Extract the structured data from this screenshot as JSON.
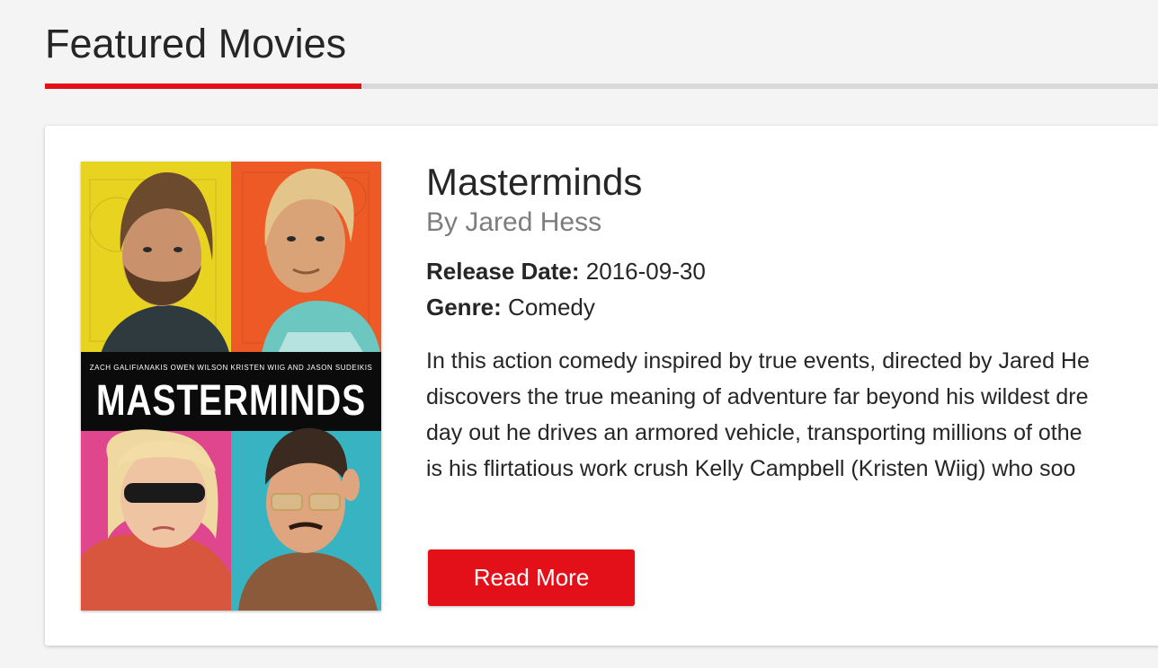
{
  "section": {
    "title": "Featured Movies"
  },
  "movie": {
    "title": "Masterminds",
    "director": "By Jared Hess",
    "release_label": "Release Date:",
    "release_value": "2016-09-30",
    "genre_label": "Genre:",
    "genre_value": "Comedy",
    "synopsis_lines": [
      "In this action comedy inspired by true events, directed by Jared He",
      "discovers the true meaning of adventure far beyond his wildest dre",
      "day out he drives an armored vehicle, transporting millions of othe",
      "is his flirtatious work crush Kelly Campbell (Kristen Wiig) who soo"
    ],
    "read_more_label": "Read More"
  },
  "poster": {
    "title": "MASTERMINDS",
    "cast": [
      "ZACH GALIFIANAKIS",
      "OWEN WILSON",
      "KRISTEN WIIG",
      "AND",
      "JASON SUDEIKIS"
    ],
    "colors": {
      "top_left": "#e8d321",
      "top_right": "#ee5a26",
      "bottom_left": "#e0468e",
      "bottom_right": "#37b3c2",
      "band": "#0b0b0b",
      "accent": "#e3101a"
    }
  },
  "theme": {
    "accent": "#e3101a",
    "rule": "#d9d9d9",
    "background": "#f4f4f4"
  }
}
